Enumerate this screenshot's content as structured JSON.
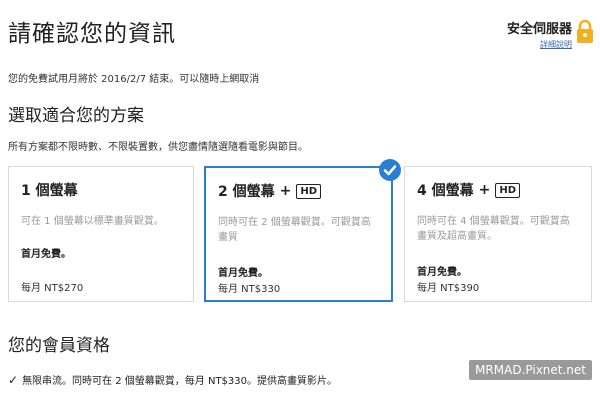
{
  "header": {
    "title": "請確認您的資訊",
    "secure_label": "安全伺服器",
    "secure_link": "詳細說明"
  },
  "trial_text": "您的免費試用月將於 2016/2/7 結束。可以隨時上網取消",
  "plans_section": {
    "title": "選取適合您的方案",
    "subtitle": "所有方案都不限時數、不限裝置數，供您盡情隨選隨看電影與節目。",
    "plans": [
      {
        "name": "1 個螢幕",
        "plus": "",
        "hd": "",
        "description": "可在 1 個螢幕以標準畫質觀賞。",
        "free_label": "首月免費。",
        "price": "每月 NT$270",
        "selected": false
      },
      {
        "name": "2 個螢幕",
        "plus": "+",
        "hd": "HD",
        "description": "同時可在 2 個螢幕觀賞。可觀賞高畫質",
        "free_label": "首月免費。",
        "price": "每月 NT$330",
        "selected": true
      },
      {
        "name": "4 個螢幕",
        "plus": "+",
        "hd": "HD",
        "description": "同時可在 4 個螢幕觀賞。可觀賞高畫質及超高畫質。",
        "free_label": "首月免費。",
        "price": "每月 NT$390",
        "selected": false
      }
    ]
  },
  "membership": {
    "title": "您的會員資格",
    "check": "✓",
    "benefit": "無限串流。同時可在 2 個螢幕觀賞，每月 NT$330。提供高畫質影片。"
  },
  "watermark": "MRMAD.Pixnet.net",
  "colors": {
    "accent": "#2b7fd3",
    "lock": "#f2b01e",
    "link": "#3b6cb7"
  }
}
